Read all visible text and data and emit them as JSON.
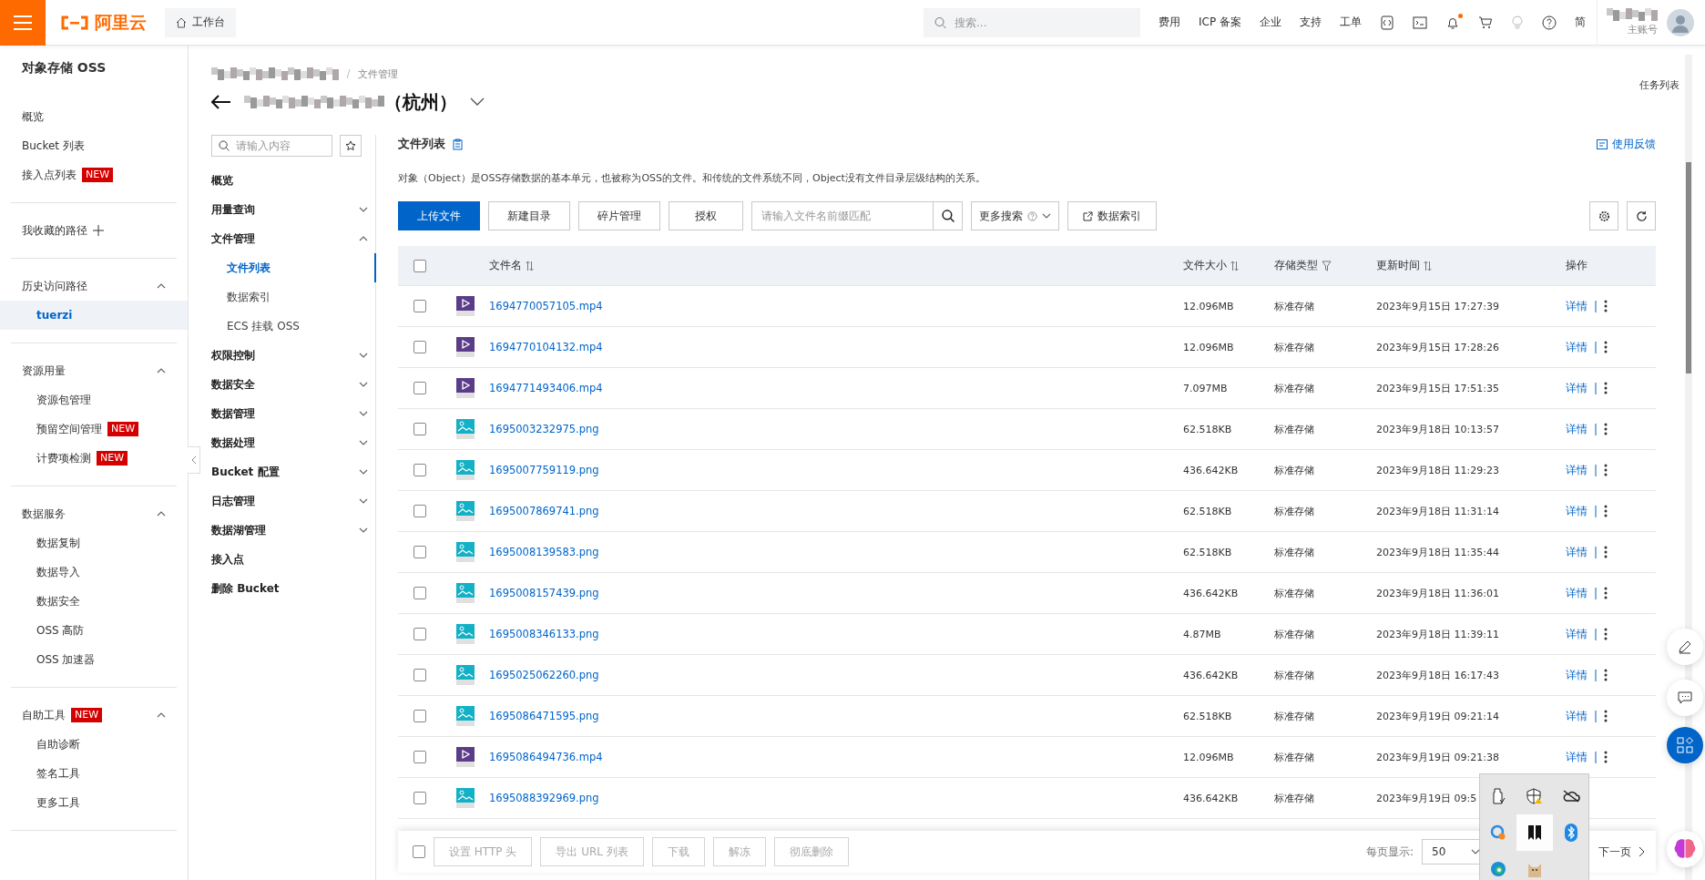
{
  "topbar": {
    "logo": "阿里云",
    "workbench": "工作台",
    "search_placeholder": "搜索...",
    "links": [
      "费用",
      "ICP 备案",
      "企业",
      "支持",
      "工单"
    ],
    "notification_dot": true,
    "language": "简",
    "account_type": "主账号"
  },
  "sidebar": {
    "title": "对象存储 OSS",
    "sections": [
      {
        "kind": "list",
        "items": [
          {
            "label": "概览",
            "selected": false
          },
          {
            "label": "Bucket 列表",
            "selected": false
          },
          {
            "label": "接入点列表",
            "badge": "NEW",
            "selected": false
          }
        ]
      },
      {
        "kind": "favorites",
        "header": "我收藏的路径"
      },
      {
        "kind": "group",
        "header": "历史访问路径",
        "expanded": true,
        "items": [
          {
            "label": "tuerzi",
            "selected": true
          }
        ]
      },
      {
        "kind": "group",
        "header": "资源用量",
        "expanded": true,
        "items": [
          {
            "label": "资源包管理",
            "selected": false
          },
          {
            "label": "预留空间管理",
            "badge": "NEW",
            "selected": false
          },
          {
            "label": "计费项检测",
            "badge": "NEW",
            "selected": false
          }
        ]
      },
      {
        "kind": "group",
        "header": "数据服务",
        "expanded": true,
        "items": [
          {
            "label": "数据复制",
            "selected": false
          },
          {
            "label": "数据导入",
            "selected": false
          },
          {
            "label": "数据安全",
            "selected": false
          },
          {
            "label": "OSS 高防",
            "selected": false
          },
          {
            "label": "OSS 加速器",
            "selected": false
          }
        ]
      },
      {
        "kind": "group",
        "header": "自助工具",
        "header_badge": "NEW",
        "expanded": true,
        "items": [
          {
            "label": "自助诊断",
            "selected": false
          },
          {
            "label": "签名工具",
            "selected": false
          },
          {
            "label": "更多工具",
            "selected": false
          }
        ]
      }
    ]
  },
  "header": {
    "breadcrumb": "文件管理",
    "title_suffix": "（杭州）",
    "task_list": "任务列表"
  },
  "bucket_nav": {
    "search_placeholder": "请输入内容",
    "items": [
      {
        "label": "概览"
      },
      {
        "label": "用量查询",
        "expanded": false
      },
      {
        "label": "文件管理",
        "expanded": true,
        "children": [
          {
            "label": "文件列表",
            "selected": true
          },
          {
            "label": "数据索引",
            "selected": false
          },
          {
            "label": "ECS 挂载 OSS",
            "selected": false
          }
        ]
      },
      {
        "label": "权限控制",
        "expanded": false
      },
      {
        "label": "数据安全",
        "expanded": false
      },
      {
        "label": "数据管理",
        "expanded": false
      },
      {
        "label": "数据处理",
        "expanded": false
      },
      {
        "label": "Bucket 配置",
        "expanded": false
      },
      {
        "label": "日志管理",
        "expanded": false
      },
      {
        "label": "数据湖管理",
        "expanded": false
      },
      {
        "label": "接入点"
      },
      {
        "label": "删除 Bucket"
      }
    ]
  },
  "main": {
    "title": "文件列表",
    "feedback": "使用反馈",
    "description": "对象（Object）是OSS存储数据的基本单元，也被称为OSS的文件。和传统的文件系统不同，Object没有文件目录层级结构的关系。",
    "toolbar": {
      "buttons": [
        {
          "label": "上传文件",
          "kind": "primary"
        },
        {
          "label": "新建目录",
          "kind": "default"
        },
        {
          "label": "碎片管理",
          "kind": "default"
        },
        {
          "label": "授权",
          "kind": "default"
        }
      ],
      "search_placeholder": "请输入文件名前缀匹配",
      "more_search": "更多搜索",
      "index_button": "数据索引"
    },
    "table": {
      "all_checked": false,
      "columns": [
        {
          "label": "文件名",
          "kind": "sort"
        },
        {
          "label": "文件大小",
          "kind": "sort"
        },
        {
          "label": "存储类型",
          "kind": "filter"
        },
        {
          "label": "更新时间",
          "kind": "sort"
        },
        {
          "label": "操作",
          "kind": "plain"
        }
      ],
      "rows": [
        {
          "checked": false,
          "kind": "video",
          "name": "1694770057105.mp4",
          "size": "12.096MB",
          "storage": "标准存储",
          "updated": "2023年9月15日 17:27:39",
          "action": "详情"
        },
        {
          "checked": false,
          "kind": "video",
          "name": "1694770104132.mp4",
          "size": "12.096MB",
          "storage": "标准存储",
          "updated": "2023年9月15日 17:28:26",
          "action": "详情"
        },
        {
          "checked": false,
          "kind": "video",
          "name": "1694771493406.mp4",
          "size": "7.097MB",
          "storage": "标准存储",
          "updated": "2023年9月15日 17:51:35",
          "action": "详情"
        },
        {
          "checked": false,
          "kind": "image",
          "name": "1695003232975.png",
          "size": "62.518KB",
          "storage": "标准存储",
          "updated": "2023年9月18日 10:13:57",
          "action": "详情"
        },
        {
          "checked": false,
          "kind": "image",
          "name": "1695007759119.png",
          "size": "436.642KB",
          "storage": "标准存储",
          "updated": "2023年9月18日 11:29:23",
          "action": "详情"
        },
        {
          "checked": false,
          "kind": "image",
          "name": "1695007869741.png",
          "size": "62.518KB",
          "storage": "标准存储",
          "updated": "2023年9月18日 11:31:14",
          "action": "详情"
        },
        {
          "checked": false,
          "kind": "image",
          "name": "1695008139583.png",
          "size": "62.518KB",
          "storage": "标准存储",
          "updated": "2023年9月18日 11:35:44",
          "action": "详情"
        },
        {
          "checked": false,
          "kind": "image",
          "name": "1695008157439.png",
          "size": "436.642KB",
          "storage": "标准存储",
          "updated": "2023年9月18日 11:36:01",
          "action": "详情"
        },
        {
          "checked": false,
          "kind": "image",
          "name": "1695008346133.png",
          "size": "4.87MB",
          "storage": "标准存储",
          "updated": "2023年9月18日 11:39:11",
          "action": "详情"
        },
        {
          "checked": false,
          "kind": "image",
          "name": "1695025062260.png",
          "size": "436.642KB",
          "storage": "标准存储",
          "updated": "2023年9月18日 16:17:43",
          "action": "详情"
        },
        {
          "checked": false,
          "kind": "image",
          "name": "1695086471595.png",
          "size": "62.518KB",
          "storage": "标准存储",
          "updated": "2023年9月19日 09:21:14",
          "action": "详情"
        },
        {
          "checked": false,
          "kind": "video",
          "name": "1695086494736.mp4",
          "size": "12.096MB",
          "storage": "标准存储",
          "updated": "2023年9月19日 09:21:38",
          "action": "详情"
        },
        {
          "checked": false,
          "kind": "image",
          "name": "1695088392969.png",
          "size": "436.642KB",
          "storage": "标准存储",
          "updated": "2023年9月19日 09:5"
        }
      ]
    },
    "bulk_bar": {
      "checked": false,
      "buttons": [
        {
          "label": "设置 HTTP 头",
          "disabled": true
        },
        {
          "label": "导出 URL 列表",
          "disabled": true
        },
        {
          "label": "下载",
          "disabled": true
        },
        {
          "label": "解冻",
          "disabled": true
        },
        {
          "label": "彻底删除",
          "disabled": true
        }
      ],
      "page_size_label": "每页显示:",
      "page_size": "50",
      "next": "下一页"
    }
  },
  "tray": {
    "items": [
      {
        "kind": "usb",
        "selected": false
      },
      {
        "kind": "shield",
        "selected": false
      },
      {
        "kind": "cloud",
        "selected": false
      },
      {
        "kind": "sync",
        "selected": false
      },
      {
        "kind": "app",
        "selected": true
      },
      {
        "kind": "bluetooth",
        "selected": false
      },
      {
        "kind": "edge",
        "selected": false
      },
      {
        "kind": "cat",
        "selected": false
      }
    ]
  }
}
